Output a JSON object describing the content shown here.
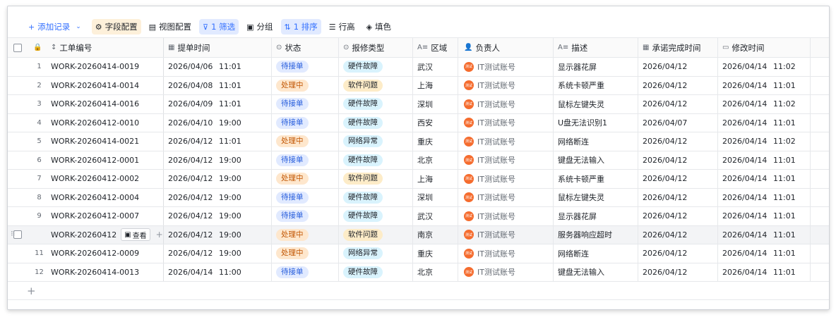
{
  "toolbar": {
    "add_label": "添加记录",
    "field_config": "字段配置",
    "view_config": "视图配置",
    "filter": "1 筛选",
    "group": "分组",
    "sort": "1 排序",
    "row_height": "行高",
    "fill_color": "填色"
  },
  "columns": {
    "id": "工单编号",
    "submit_time": "提单时间",
    "status": "状态",
    "type": "报修类型",
    "region": "区域",
    "owner": "负责人",
    "desc": "描述",
    "promise_time": "承诺完成时间",
    "modify_time": "修改时间"
  },
  "view_label": "查看",
  "rows": [
    {
      "no": "1",
      "id": "WORK-20260414-0019",
      "date": "2026/04/06",
      "time": "11:01",
      "status": "待接单",
      "type": "硬件故障",
      "region": "武汉",
      "owner": "IT测试账号",
      "desc": "显示器花屏",
      "promise": "2026/04/12",
      "mdate": "2026/04/14",
      "mtime": "11:02"
    },
    {
      "no": "2",
      "id": "WORK-20260414-0014",
      "date": "2026/04/08",
      "time": "11:01",
      "status": "处理中",
      "type": "软件问题",
      "region": "上海",
      "owner": "IT测试账号",
      "desc": "系统卡顿严重",
      "promise": "2026/04/12",
      "mdate": "2026/04/14",
      "mtime": "11:01"
    },
    {
      "no": "3",
      "id": "WORK-20260414-0016",
      "date": "2026/04/09",
      "time": "11:01",
      "status": "待接单",
      "type": "硬件故障",
      "region": "深圳",
      "owner": "IT测试账号",
      "desc": "鼠标左键失灵",
      "promise": "2026/04/12",
      "mdate": "2026/04/14",
      "mtime": "11:02"
    },
    {
      "no": "4",
      "id": "WORK-20260412-0010",
      "date": "2026/04/10",
      "time": "19:00",
      "status": "待接单",
      "type": "硬件故障",
      "region": "西安",
      "owner": "IT测试账号",
      "desc": "U盘无法识别1",
      "promise": "2026/04/07",
      "mdate": "2026/04/14",
      "mtime": "11:01"
    },
    {
      "no": "5",
      "id": "WORK-20260414-0021",
      "date": "2026/04/12",
      "time": "11:01",
      "status": "处理中",
      "type": "网络异常",
      "region": "重庆",
      "owner": "IT测试账号",
      "desc": "网络断连",
      "promise": "2026/04/12",
      "mdate": "2026/04/14",
      "mtime": "11:02"
    },
    {
      "no": "6",
      "id": "WORK-20260412-0001",
      "date": "2026/04/12",
      "time": "19:00",
      "status": "待接单",
      "type": "硬件故障",
      "region": "北京",
      "owner": "IT测试账号",
      "desc": "键盘无法输入",
      "promise": "2026/04/12",
      "mdate": "2026/04/14",
      "mtime": "11:01"
    },
    {
      "no": "7",
      "id": "WORK-20260412-0002",
      "date": "2026/04/12",
      "time": "19:00",
      "status": "处理中",
      "type": "软件问题",
      "region": "上海",
      "owner": "IT测试账号",
      "desc": "系统卡顿严重",
      "promise": "2026/04/12",
      "mdate": "2026/04/14",
      "mtime": "11:01"
    },
    {
      "no": "8",
      "id": "WORK-20260412-0004",
      "date": "2026/04/12",
      "time": "19:00",
      "status": "待接单",
      "type": "硬件故障",
      "region": "深圳",
      "owner": "IT测试账号",
      "desc": "鼠标左键失灵",
      "promise": "2026/04/12",
      "mdate": "2026/04/14",
      "mtime": "11:01"
    },
    {
      "no": "9",
      "id": "WORK-20260412-0007",
      "date": "2026/04/12",
      "time": "19:00",
      "status": "待接单",
      "type": "硬件故障",
      "region": "武汉",
      "owner": "IT测试账号",
      "desc": "显示器花屏",
      "promise": "2026/04/12",
      "mdate": "2026/04/14",
      "mtime": "11:01"
    },
    {
      "no": "",
      "id": "WORK-20260412",
      "date": "2026/04/12",
      "time": "19:00",
      "status": "处理中",
      "type": "软件问题",
      "region": "南京",
      "owner": "IT测试账号",
      "desc": "服务器响应超时",
      "promise": "2026/04/12",
      "mdate": "2026/04/14",
      "mtime": "11:01",
      "hover": true
    },
    {
      "no": "11",
      "id": "WORK-20260412-0009",
      "date": "2026/04/12",
      "time": "19:00",
      "status": "处理中",
      "type": "网络异常",
      "region": "重庆",
      "owner": "IT测试账号",
      "desc": "网络断连",
      "promise": "2026/04/12",
      "mdate": "2026/04/14",
      "mtime": "11:01"
    },
    {
      "no": "12",
      "id": "WORK-20260414-0013",
      "date": "2026/04/14",
      "time": "11:00",
      "status": "待接单",
      "type": "硬件故障",
      "region": "北京",
      "owner": "IT测试账号",
      "desc": "键盘无法输入",
      "promise": "2026/04/12",
      "mdate": "2026/04/14",
      "mtime": "11:01"
    }
  ]
}
